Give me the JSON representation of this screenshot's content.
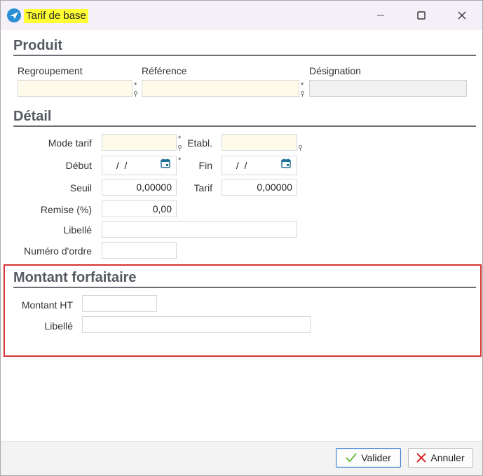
{
  "window": {
    "title": "Tarif de base",
    "minimize_glyph": "—",
    "maximize_glyph": "☐",
    "close_glyph": "✕"
  },
  "produit": {
    "title": "Produit",
    "regroupement_label": "Regroupement",
    "reference_label": "Référence",
    "designation_label": "Désignation",
    "regroupement_value": "",
    "reference_value": "",
    "designation_value": "",
    "required_mark": "*"
  },
  "detail": {
    "title": "Détail",
    "mode_tarif_label": "Mode tarif",
    "etabl_label": "Etabl.",
    "debut_label": "Début",
    "fin_label": "Fin",
    "seuil_label": "Seuil",
    "tarif_label": "Tarif",
    "remise_label": "Remise (%)",
    "libelle_label": "Libellé",
    "numero_ordre_label": "Numéro d'ordre",
    "mode_tarif_value": "",
    "etabl_value": "",
    "debut_value": " /  /",
    "fin_value": " /  /",
    "seuil_value": "0,00000",
    "tarif_value": "0,00000",
    "remise_value": "0,00",
    "libelle_value": "",
    "numero_ordre_value": "",
    "required_mark": "*"
  },
  "montant": {
    "title": "Montant forfaitaire",
    "montant_ht_label": "Montant HT",
    "libelle_label": "Libellé",
    "montant_ht_value": "",
    "libelle_value": ""
  },
  "footer": {
    "valider_label": "Valider",
    "annuler_label": "Annuler"
  },
  "colors": {
    "title_highlight": "#ffff33",
    "required_field": "#fffbea",
    "highlight_box": "#d43535",
    "valider_check": "#6cbf45",
    "annuler_x": "#d9292f",
    "calendar_icon": "#1f6f95"
  }
}
